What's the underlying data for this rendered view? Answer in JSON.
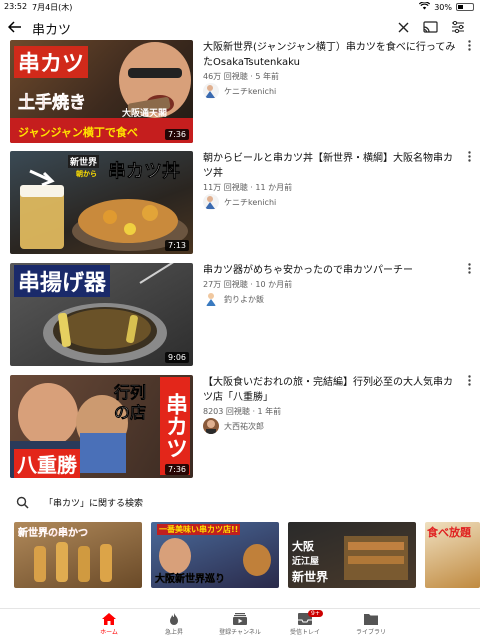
{
  "status_bar": {
    "time": "23:52",
    "date": "7月4日(木)",
    "battery": "30%"
  },
  "search": {
    "query": "串カツ"
  },
  "videos": [
    {
      "title": "大阪新世界(ジャンジャン横丁）串カツを食べに行ってみたOsakaTsutenkaku",
      "meta": "46万 回視聴 · 5 年前",
      "channel": "ケニチkenichi",
      "duration": "7:36",
      "thumb_text": [
        "串カツ",
        "土手焼き",
        "大阪通天閣",
        "ジャンジャン横丁で食べ"
      ]
    },
    {
      "title": "朝からビールと串カツ丼【新世界・横綱】大阪名物串カツ丼",
      "meta": "11万 回視聴 · 11 か月前",
      "channel": "ケニチkenichi",
      "duration": "7:13",
      "thumb_text": [
        "新世界",
        "朝から",
        "串カツ丼"
      ]
    },
    {
      "title": "串カツ器がめちゃ安かったので串カツパーチー",
      "meta": "27万 回視聴 · 10 か月前",
      "channel": "釣りよか飯",
      "duration": "9:06",
      "thumb_text": [
        "串揚げ器"
      ]
    },
    {
      "title": "【大阪食いだおれの旅・完結編】行列必至の大人気串カツ店「八重勝」",
      "meta": "8203 回視聴 · 1 年前",
      "channel": "大西祐次郎",
      "duration": "7:36",
      "thumb_text": [
        "行列",
        "の店",
        "串カツ",
        "八重勝"
      ]
    }
  ],
  "related": {
    "label": "「串カツ」に関する検索",
    "cards": [
      {
        "text": "新世界の串かつ"
      },
      {
        "text": "一番美味い串カツ店!!",
        "sub": "大阪新世界巡り"
      },
      {
        "text": "大阪",
        "sub": "近江屋",
        "sub2": "新世界"
      },
      {
        "text": "食べ放題"
      }
    ]
  },
  "bottom_nav": [
    {
      "label": "ホーム",
      "icon": "home-icon",
      "active": true
    },
    {
      "label": "急上昇",
      "icon": "trending-icon",
      "active": false
    },
    {
      "label": "登録チャンネル",
      "icon": "subscriptions-icon",
      "active": false
    },
    {
      "label": "受信トレイ",
      "icon": "inbox-icon",
      "active": false,
      "badge": "9+"
    },
    {
      "label": "ライブラリ",
      "icon": "library-icon",
      "active": false
    }
  ],
  "colors": {
    "accent": "#ff0000",
    "text": "#0f0f0f",
    "secondary": "#606060"
  }
}
